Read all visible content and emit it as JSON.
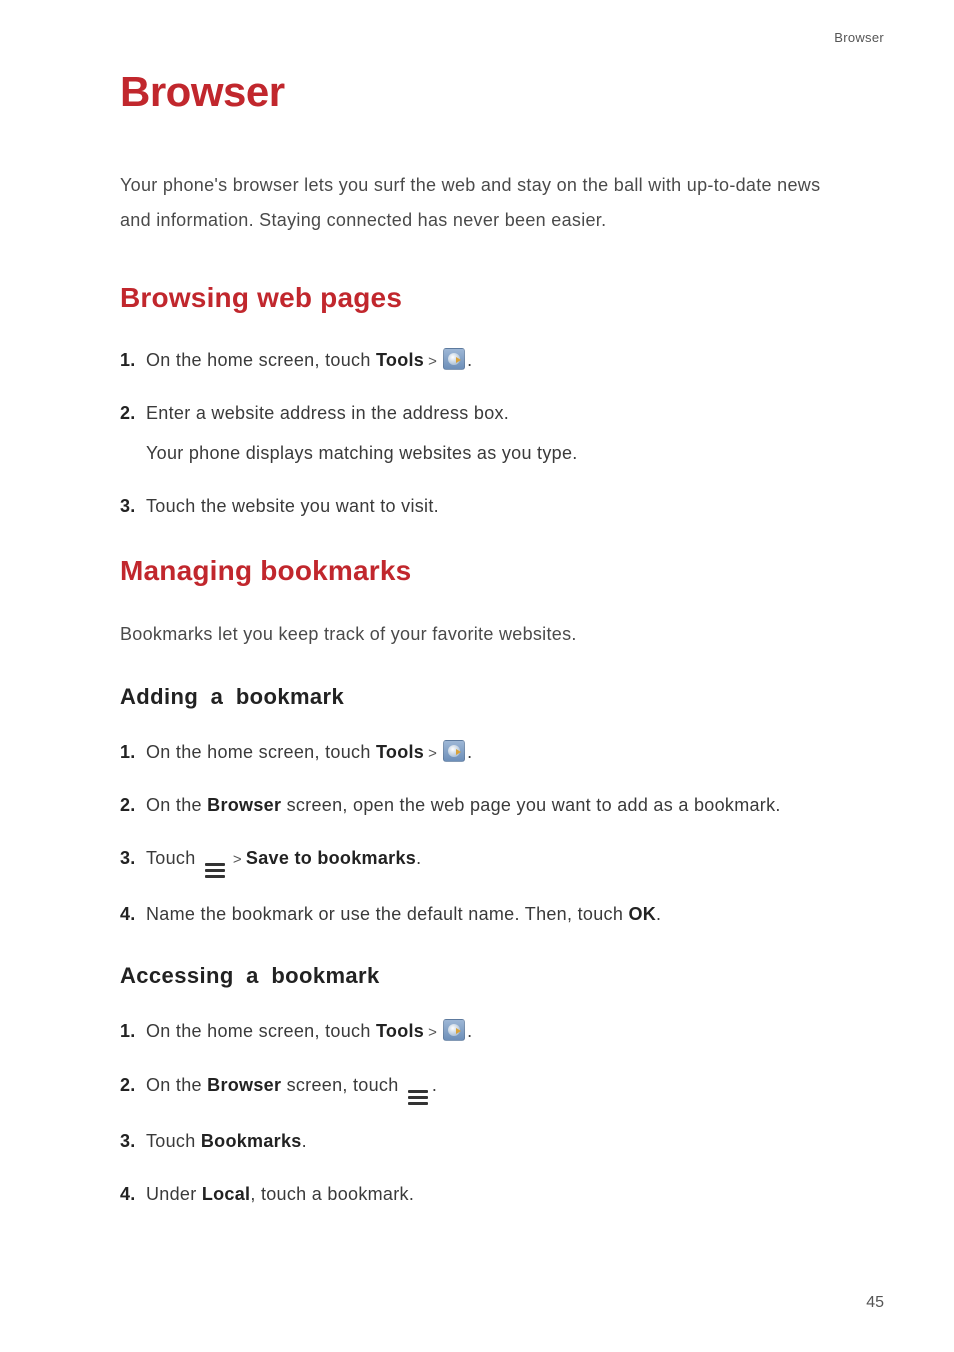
{
  "header_label": "Browser",
  "page_number": "45",
  "title": "Browser",
  "intro": "Your phone's browser lets you surf the web and stay on the ball with up-to-date news and information. Staying connected has never been easier.",
  "section_browsing": {
    "heading": "Browsing web pages",
    "steps": [
      {
        "num": "1.",
        "pre": "On the home screen, touch ",
        "bold": "Tools",
        "arrow": ">",
        "icon": "browser",
        "post": "."
      },
      {
        "num": "2.",
        "text": "Enter a website address in the address box.",
        "sub": "Your phone displays matching websites as you type."
      },
      {
        "num": "3.",
        "text": "Touch the website you want to visit."
      }
    ]
  },
  "section_bookmarks": {
    "heading": "Managing bookmarks",
    "intro": "Bookmarks let you keep track of your favorite websites.",
    "adding": {
      "heading": "Adding a bookmark",
      "steps": [
        {
          "num": "1.",
          "pre": "On the home screen, touch ",
          "bold": "Tools",
          "arrow": ">",
          "icon": "browser",
          "post": "."
        },
        {
          "num": "2.",
          "text_a": "On the ",
          "bold_a": "Browser",
          "text_b": " screen, open the web page you want to add as a bookmark."
        },
        {
          "num": "3.",
          "pre": "Touch ",
          "icon": "menu",
          "arrow": ">",
          "bold": "Save to bookmarks",
          "post": "."
        },
        {
          "num": "4.",
          "text_a": "Name the bookmark or use the default name. Then, touch ",
          "bold_a": "OK",
          "text_b": "."
        }
      ]
    },
    "accessing": {
      "heading": "Accessing a bookmark",
      "steps": [
        {
          "num": "1.",
          "pre": "On the home screen, touch ",
          "bold": "Tools",
          "arrow": ">",
          "icon": "browser",
          "post": "."
        },
        {
          "num": "2.",
          "text_a": "On the ",
          "bold_a": "Browser",
          "text_b": " screen, touch ",
          "icon": "menu",
          "text_c": "."
        },
        {
          "num": "3.",
          "pre": "Touch ",
          "bold": "Bookmarks",
          "post": "."
        },
        {
          "num": "4.",
          "text_a": "Under ",
          "bold_a": "Local",
          "text_b": ", touch a bookmark."
        }
      ]
    }
  }
}
